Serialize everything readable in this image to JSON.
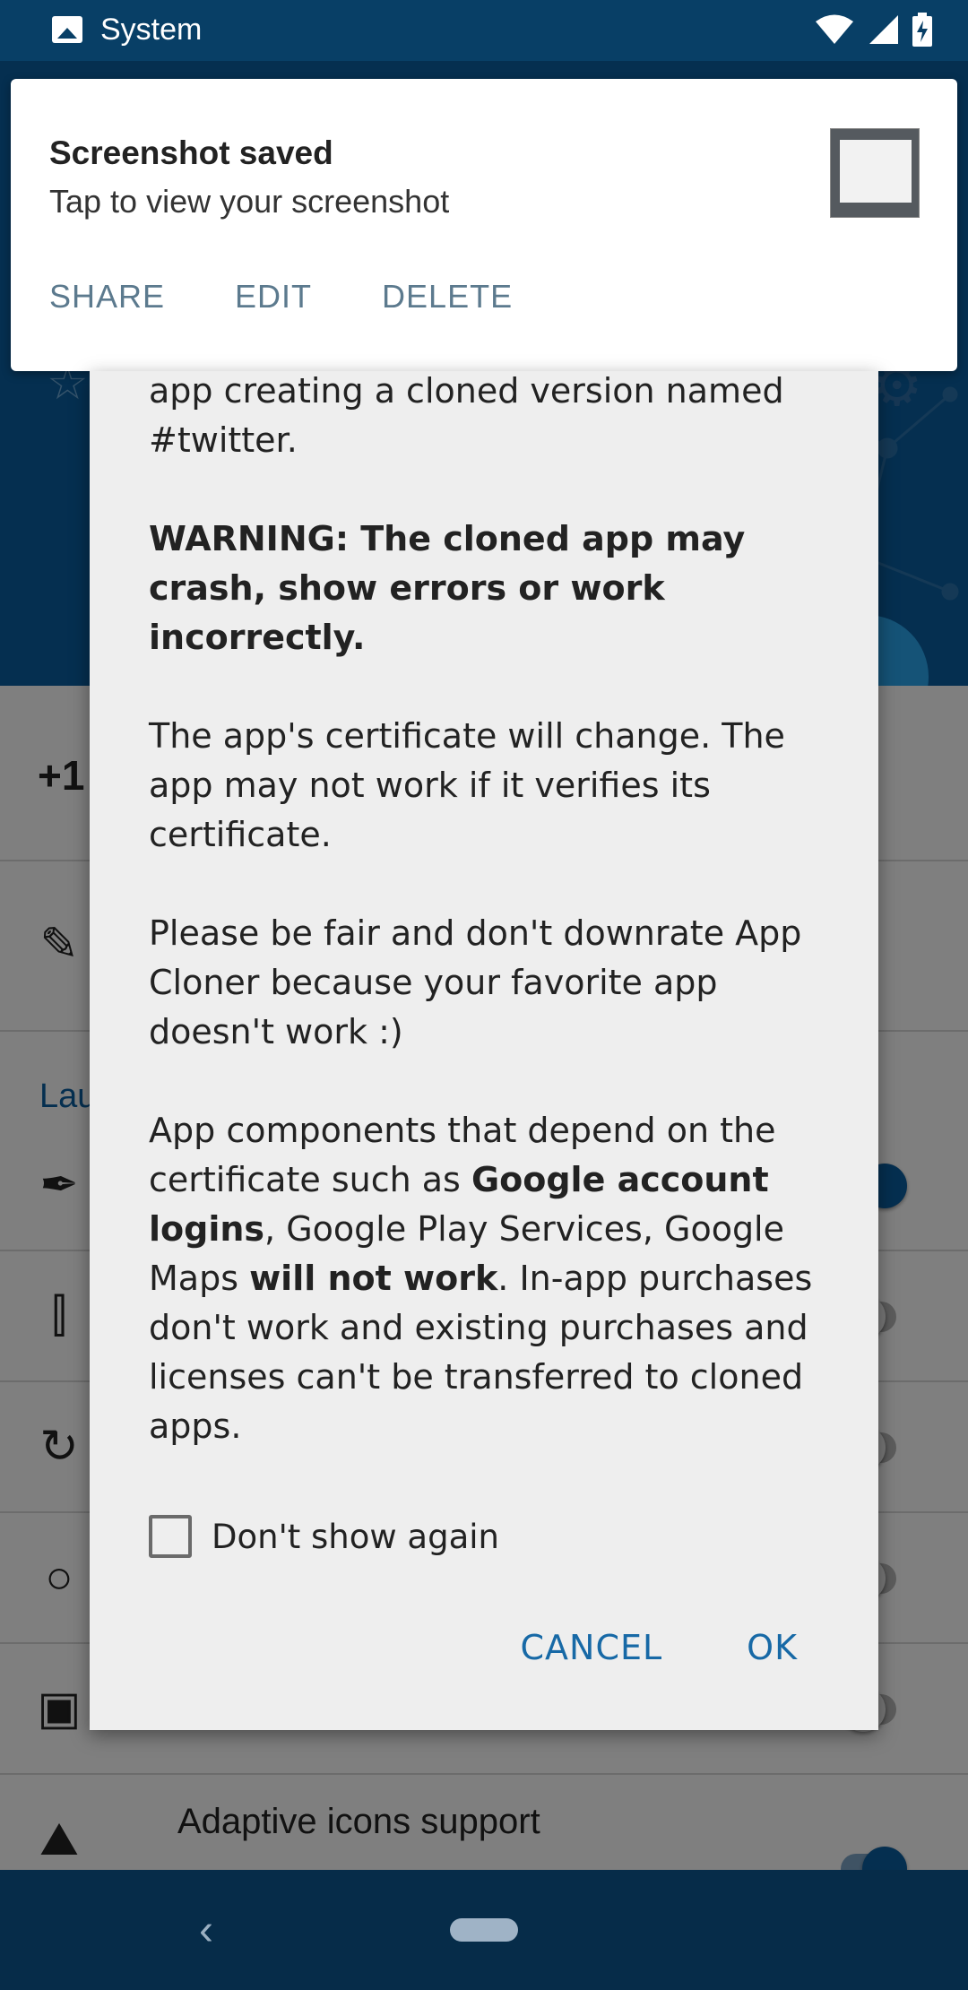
{
  "status_bar": {
    "app_label": "System",
    "icons": [
      "image-icon",
      "wifi-icon",
      "signal-icon",
      "battery-charging-icon"
    ]
  },
  "notification": {
    "title": "Screenshot saved",
    "body": "Tap to view your screenshot",
    "actions": [
      "SHARE",
      "EDIT",
      "DELETE"
    ]
  },
  "background": {
    "plus_one": "+1",
    "section_label": "Lau",
    "adaptive_icons_label": "Adaptive icons support",
    "row_icons": [
      "pencil-icon",
      "eyedropper-icon",
      "flip-icon",
      "rotate-icon",
      "circle-icon",
      "image-icon",
      "landscape-icon"
    ]
  },
  "dialog": {
    "intro_fragment": "app creating a cloned version named #twitter.",
    "warning": "WARNING: The cloned app may crash, show errors or work incorrectly.",
    "certificate_note": "The app's certificate will change. The app may not work if it verifies its certificate.",
    "fair_note": "Please be fair and don't downrate App Cloner because your favorite app doesn't work :)",
    "components": {
      "part1": "App components that depend on the certificate such as ",
      "part2_bold": "Google account logins",
      "part3": ", Google Play Services, Google Maps ",
      "part4_bold": "will not work",
      "part5": ". In-app purchases don't work and existing purchases and licenses can't be transferred to cloned apps."
    },
    "dont_show_again": "Don't show again",
    "cancel": "CANCEL",
    "ok": "OK"
  },
  "colors": {
    "status_bar": "#083f66",
    "app_header": "#0b5ea0",
    "dialog_bg": "#eeeeee",
    "dialog_button": "#1769a6",
    "notif_action": "#5c7a8e",
    "nav_bar": "#062c49"
  }
}
